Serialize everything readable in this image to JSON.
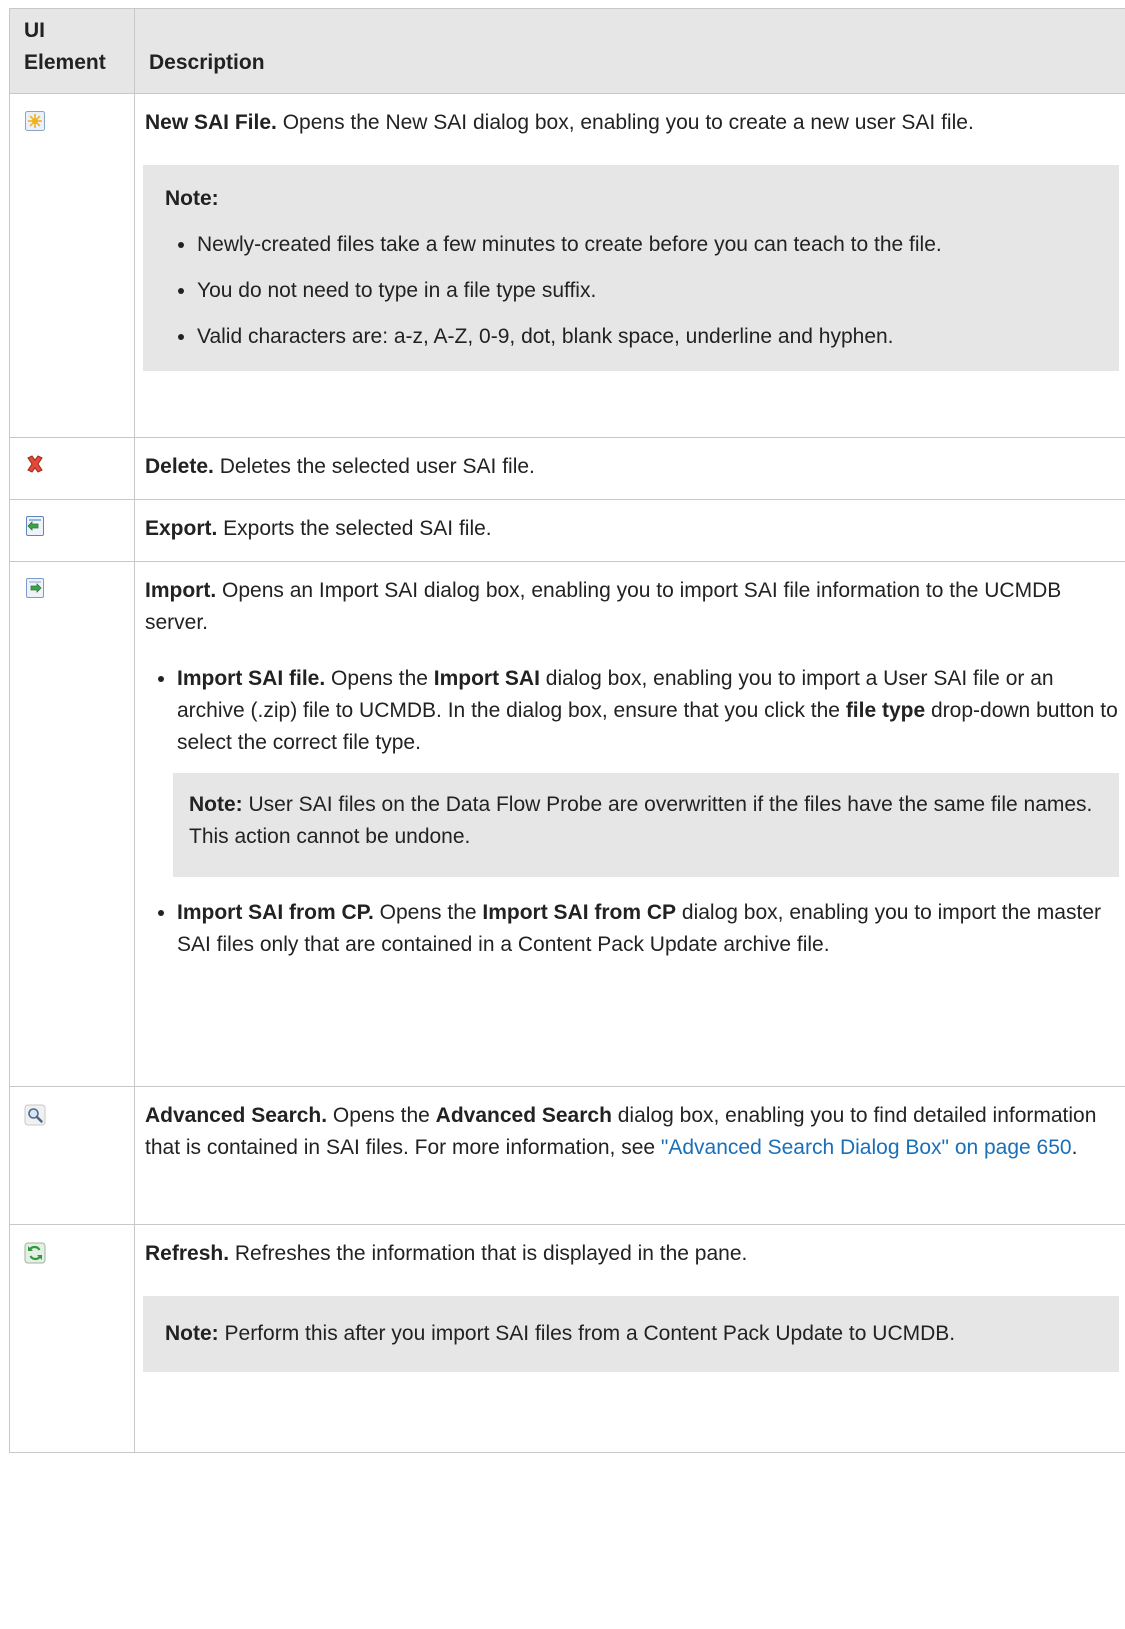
{
  "header": {
    "col1": "UI Element",
    "col2": "Description"
  },
  "rows": {
    "new": {
      "icon": "new-file-star-icon",
      "title": "New SAI File.",
      "text": " Opens the New SAI dialog box, enabling you to create a new user SAI file.",
      "note_title": "Note:",
      "notes": [
        "Newly-created files take a few minutes to create before you can teach to the file.",
        "You do not need to type in a file type suffix.",
        "Valid characters are: a-z, A-Z, 0-9, dot, blank space, underline and hyphen."
      ]
    },
    "delete": {
      "icon": "delete-x-icon",
      "title": "Delete.",
      "text": " Deletes the selected user SAI file."
    },
    "export": {
      "icon": "export-icon",
      "title": "Export.",
      "text": " Exports the selected SAI file."
    },
    "import": {
      "icon": "import-icon",
      "title": "Import.",
      "text": " Opens an Import SAI dialog box, enabling you to import SAI file information to the UCMDB server.",
      "item1": {
        "title": "Import SAI file.",
        "t1": " Opens the ",
        "b1": "Import SAI",
        "t2": " dialog box, enabling you to import a User SAI file or an archive (.zip) file to UCMDB. In the dialog box, ensure that you click the ",
        "b2": "file type",
        "t3": " drop-down button to select the correct file type.",
        "note_title": "Note:",
        "note_text": " User SAI files on the Data Flow Probe are overwritten if the files have the same file names. This action cannot be undone."
      },
      "item2": {
        "title": "Import SAI from CP.",
        "t1": " Opens the ",
        "b1": "Import SAI from CP",
        "t2": " dialog box, enabling you to import the master SAI files only that are contained in a Content Pack Update archive file."
      }
    },
    "search": {
      "icon": "magnifier-icon",
      "title": "Advanced Search.",
      "t1": " Opens the ",
      "b1": "Advanced Search",
      "t2": " dialog box, enabling you to find detailed information that is contained in SAI files. For more information, see ",
      "link": "\"Advanced Search Dialog Box\" on page 650",
      "t3": "."
    },
    "refresh": {
      "icon": "refresh-icon",
      "title": "Refresh.",
      "text": " Refreshes the information that is displayed in the pane.",
      "note_title": "Note:",
      "note_text": " Perform this after you import SAI files from a Content Pack Update to UCMDB."
    }
  },
  "colors": {
    "header_bg": "#e6e6e6",
    "note_bg": "#e6e6e6",
    "border": "#c8c8c8",
    "link": "#1a6fb9"
  }
}
